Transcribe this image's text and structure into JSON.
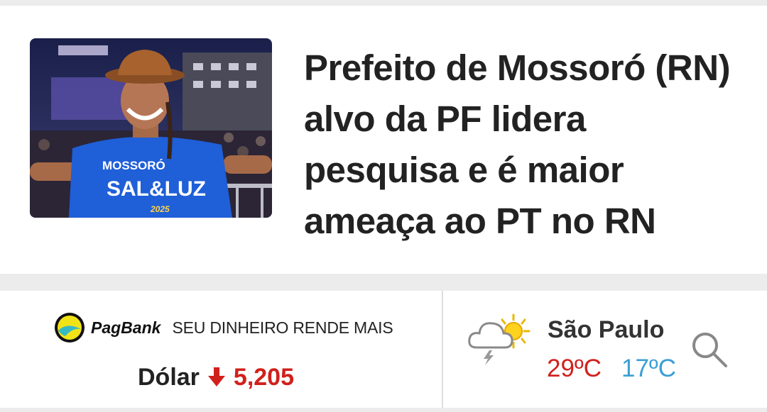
{
  "article": {
    "headline": "Prefeito de Mossoró (RN) alvo da PF lidera pesquisa e é maior ameaça ao PT no RN",
    "image": {
      "shirt_line1": "MOSSORÓ",
      "shirt_line2": "SAL&LUZ",
      "shirt_year": "2025"
    }
  },
  "market": {
    "brand": "PagBank",
    "slogan": "SEU DINHEIRO RENDE MAIS",
    "label": "Dólar",
    "value": "5,205",
    "trend": "down",
    "trend_color": "#d0201c"
  },
  "weather": {
    "city": "São Paulo",
    "max": "29ºC",
    "min": "17ºC",
    "icon": "cloud-storm-sun-icon",
    "max_color": "#d0201c",
    "min_color": "#3a9fd6"
  },
  "search": {
    "icon": "search-icon"
  }
}
